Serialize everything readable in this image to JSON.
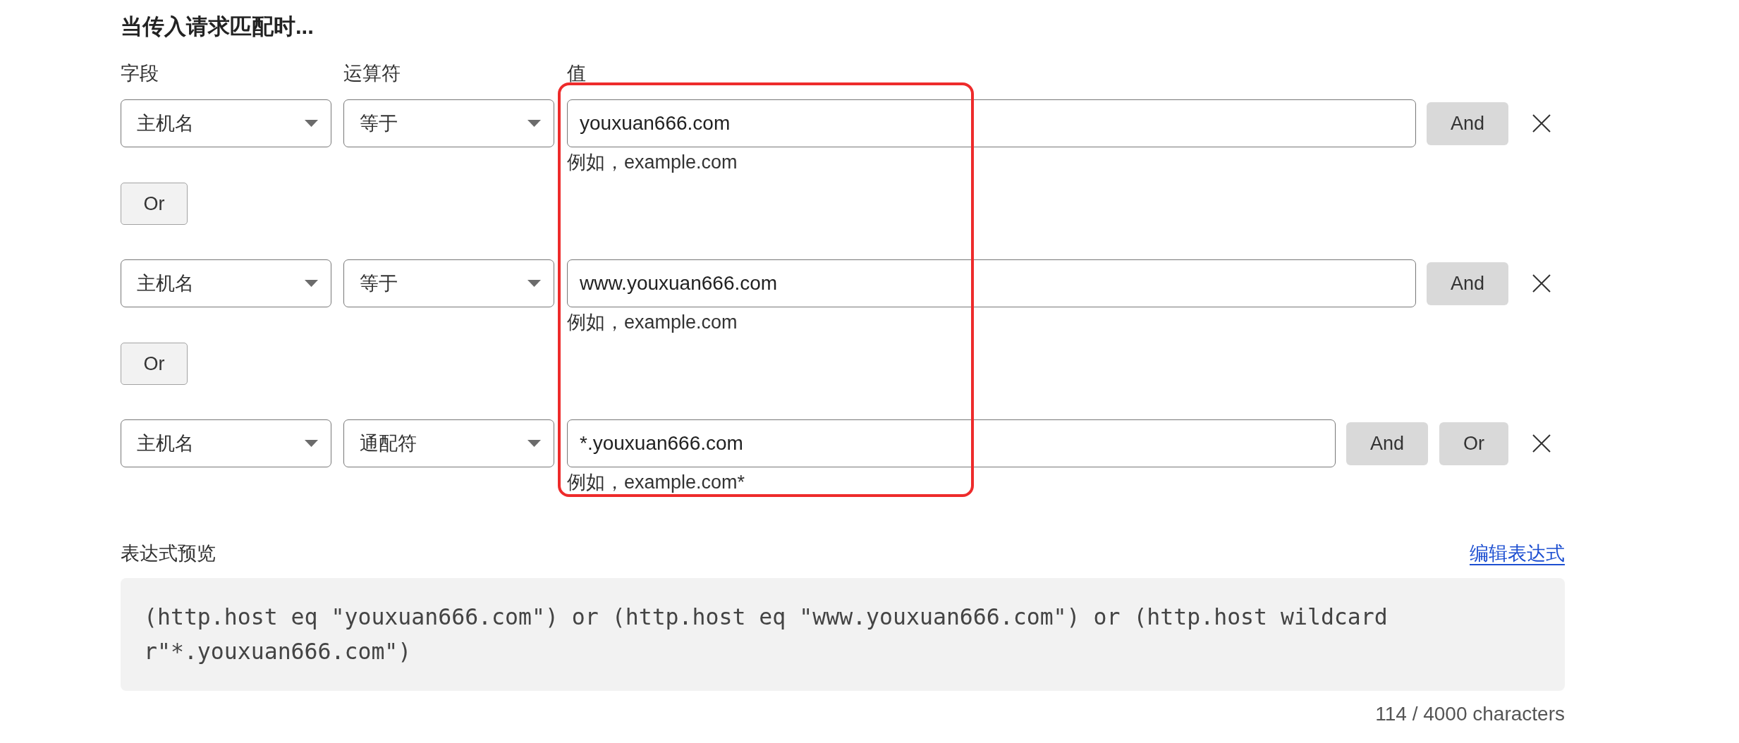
{
  "heading": "当传入请求匹配时...",
  "column_labels": [
    "字段",
    "运算符",
    "值"
  ],
  "rows": [
    {
      "kind": "condition",
      "field": "主机名",
      "operator": "等于",
      "value": "youxuan666.com",
      "hint": "例如，example.com",
      "buttons": [
        "And"
      ]
    },
    {
      "kind": "connector",
      "label": "Or"
    },
    {
      "kind": "condition",
      "field": "主机名",
      "operator": "等于",
      "value": "www.youxuan666.com",
      "hint": "例如，example.com",
      "buttons": [
        "And"
      ]
    },
    {
      "kind": "connector",
      "label": "Or"
    },
    {
      "kind": "condition",
      "field": "主机名",
      "operator": "通配符",
      "value": "*.youxuan666.com",
      "hint": "例如，example.com*",
      "buttons": [
        "And",
        "Or"
      ]
    }
  ],
  "annotation": {
    "kind": "frame"
  },
  "preview": {
    "label": "表达式预览",
    "edit_link": "编辑表达式",
    "expression": "(http.host eq \"youxuan666.com\") or (http.host eq \"www.youxuan666.com\") or (http.host wildcard r\"*.youxuan666.com\")",
    "char_count": "114 / 4000 characters"
  }
}
